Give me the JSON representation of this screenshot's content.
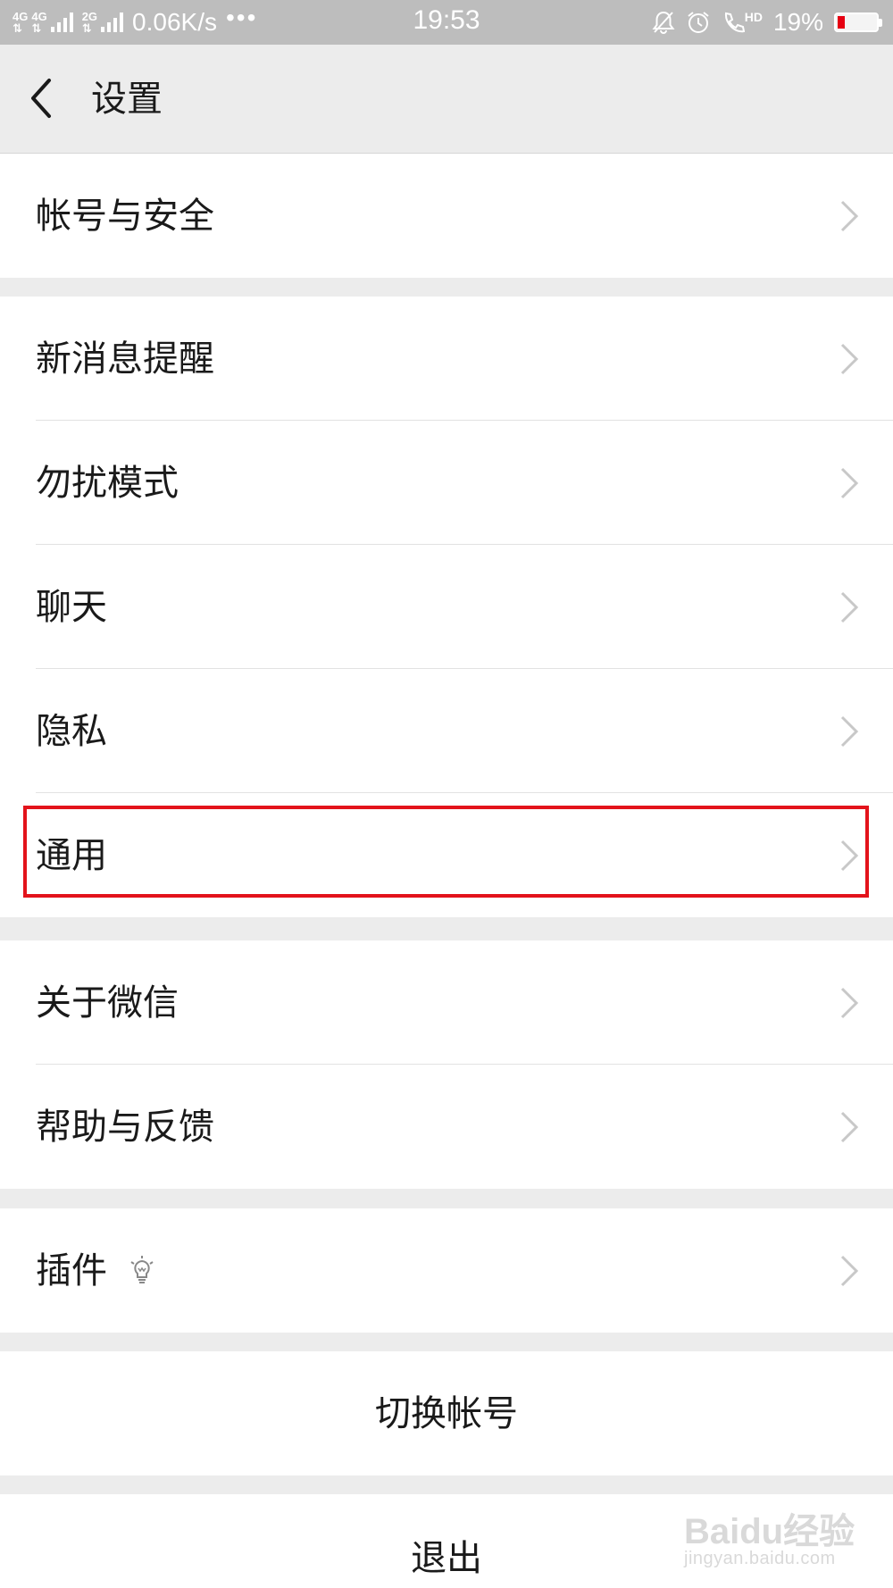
{
  "status_bar": {
    "net1": "4G",
    "net2": "4G",
    "net3": "2G",
    "speed": "0.06K/s",
    "more": "•••",
    "time": "19:53",
    "hd": "HD",
    "battery_percent": "19%",
    "battery_level": 0.19,
    "battery_color": "#e60012"
  },
  "header": {
    "back_icon": "chevron-left-icon",
    "title": "设置"
  },
  "groups": [
    {
      "items": [
        {
          "label": "帐号与安全"
        }
      ]
    },
    {
      "items": [
        {
          "label": "新消息提醒"
        },
        {
          "label": "勿扰模式"
        },
        {
          "label": "聊天"
        },
        {
          "label": "隐私"
        },
        {
          "label": "通用",
          "highlighted": true
        }
      ]
    },
    {
      "items": [
        {
          "label": "关于微信"
        },
        {
          "label": "帮助与反馈"
        }
      ]
    },
    {
      "items": [
        {
          "label": "插件",
          "icon": "lightbulb-icon"
        }
      ]
    }
  ],
  "actions": {
    "switch_account": "切换帐号",
    "logout": "退出"
  },
  "highlight_color": "#e3131b",
  "watermark": {
    "logo": "Baidu经验",
    "url": "jingyan.baidu.com"
  }
}
